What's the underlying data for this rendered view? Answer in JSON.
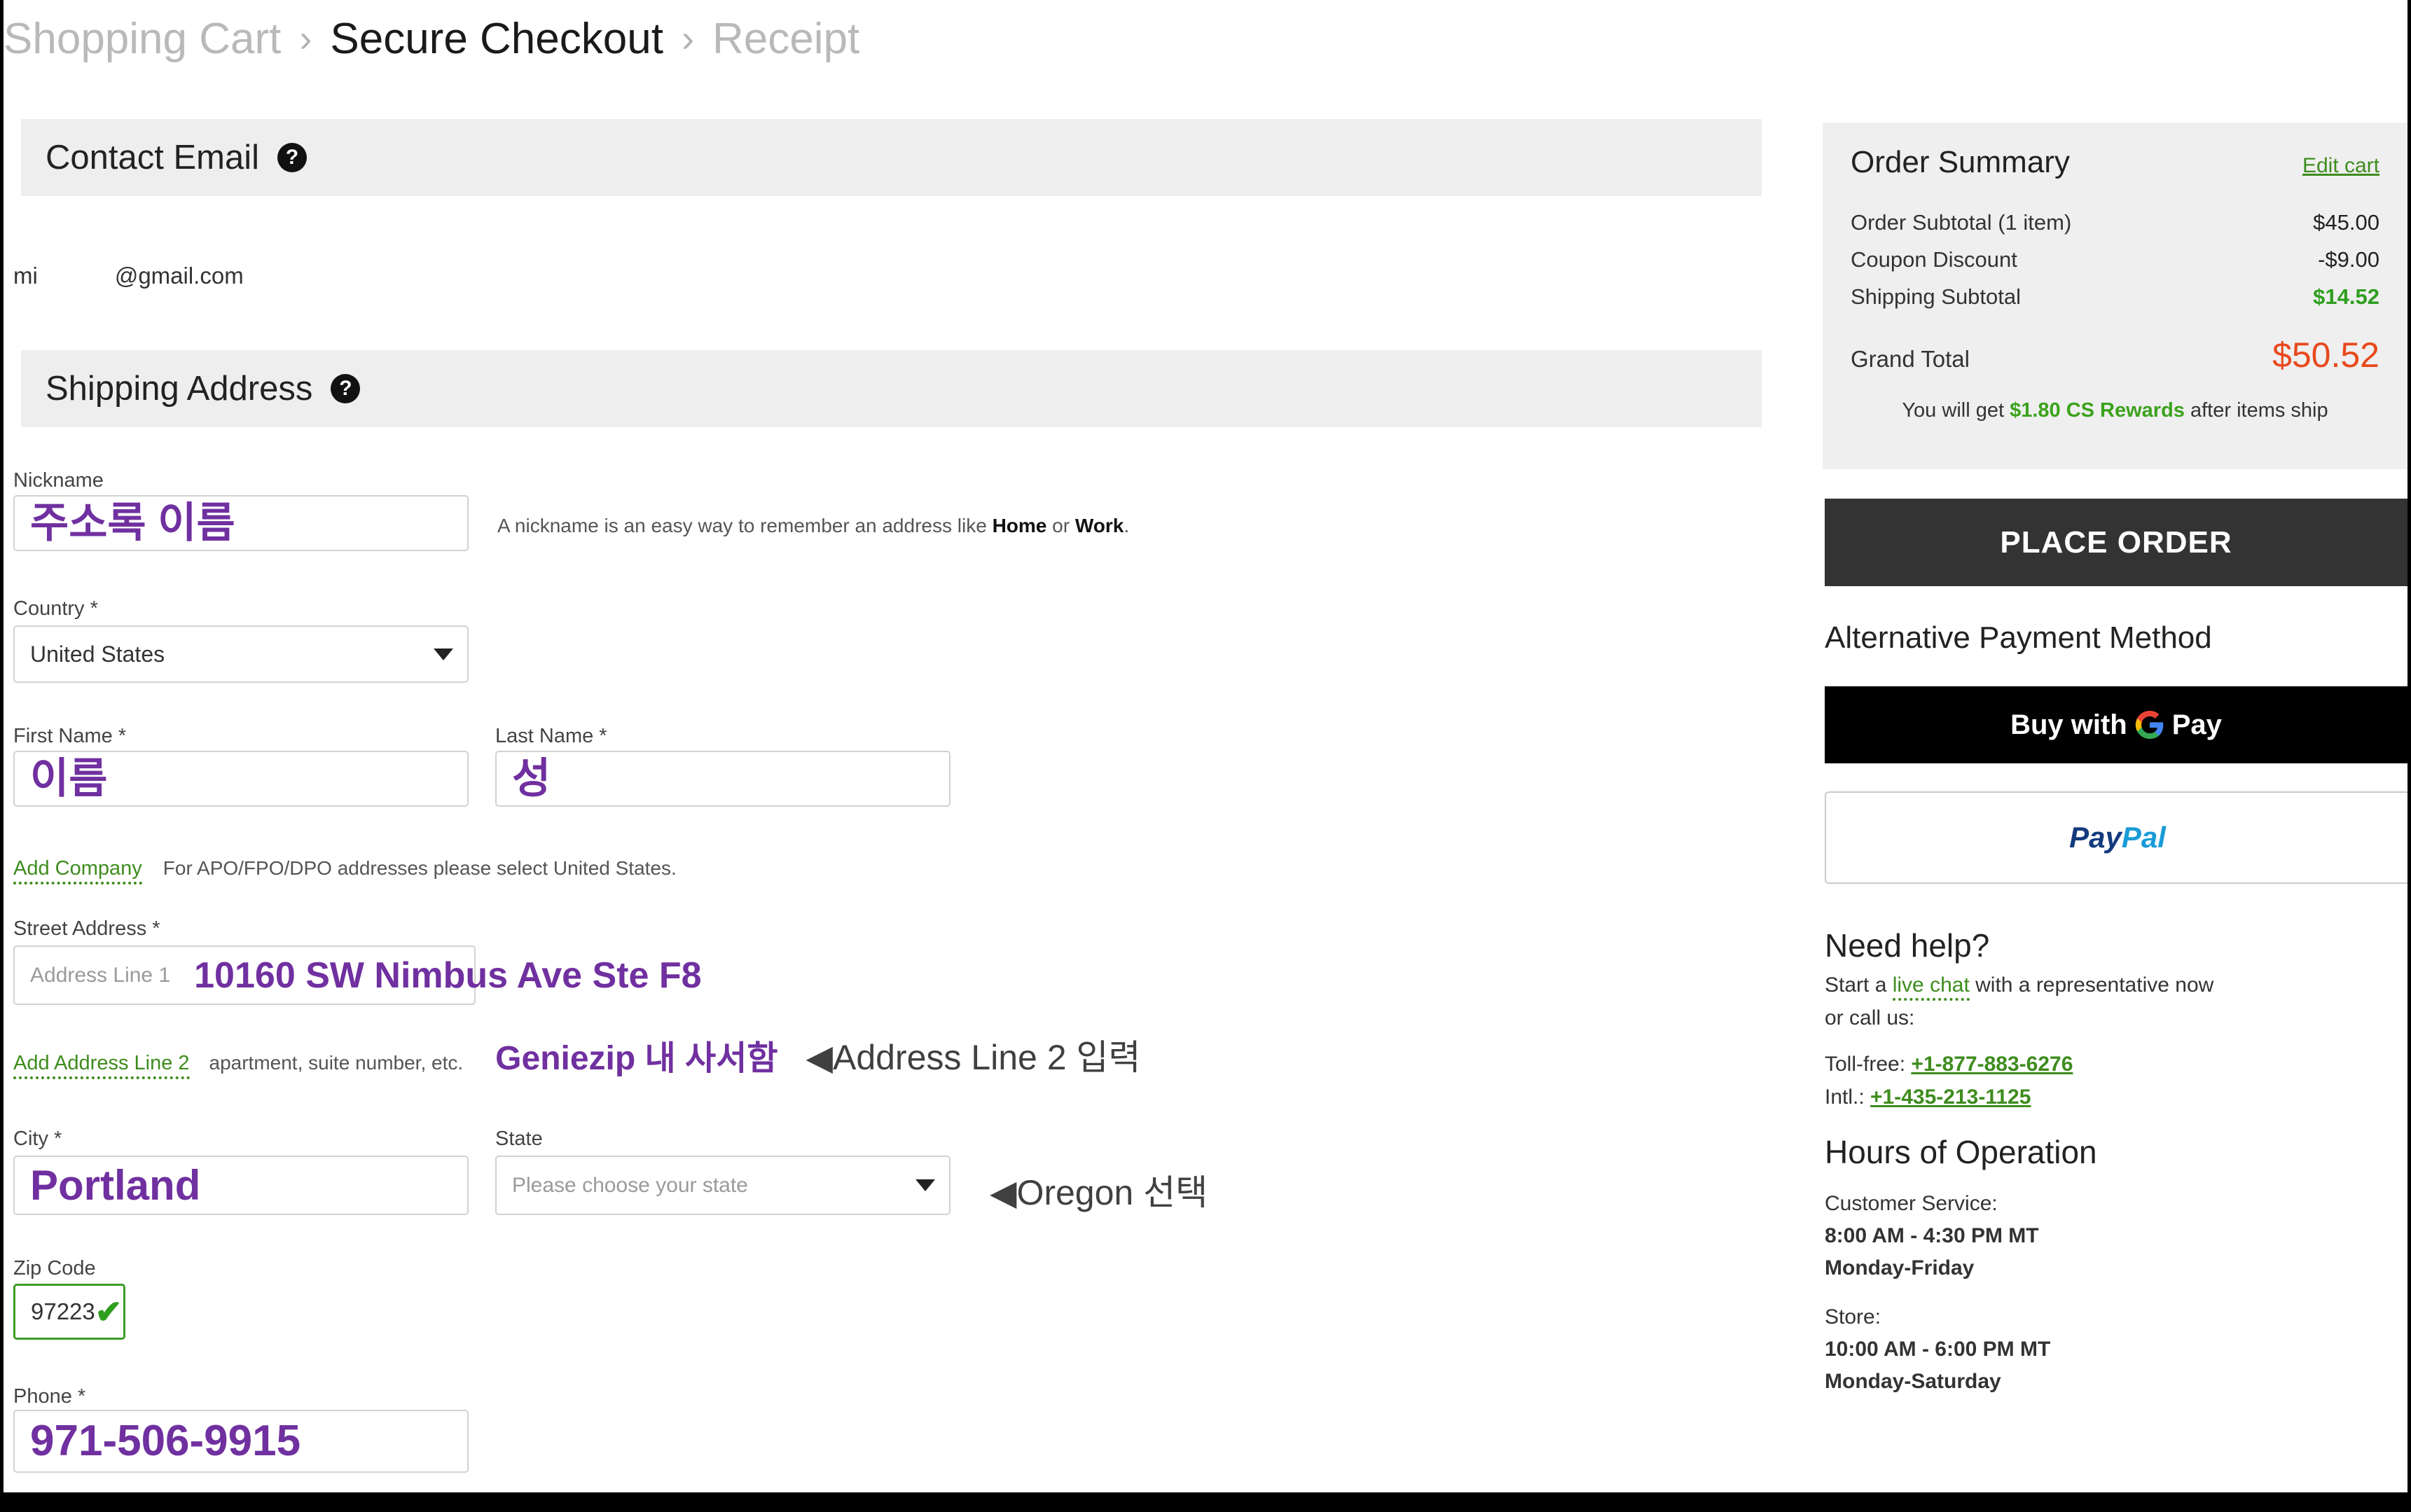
{
  "breadcrumb": {
    "items": [
      {
        "label": "Shopping Cart",
        "state": "inactive"
      },
      {
        "label": "Secure Checkout",
        "state": "active"
      },
      {
        "label": "Receipt",
        "state": "inactive"
      }
    ],
    "separator": "›"
  },
  "contact": {
    "section_title": "Contact Email",
    "help_icon": "question-mark-icon",
    "email_local": "mi",
    "email_domain": "@gmail.com"
  },
  "shipping": {
    "section_title": "Shipping Address",
    "help_icon": "question-mark-icon",
    "nickname": {
      "label": "Nickname",
      "value": "주소록 이름",
      "helper_prefix": "A nickname is an easy way to remember an address like ",
      "helper_home": "Home",
      "helper_or": " or ",
      "helper_work": "Work",
      "helper_suffix": "."
    },
    "country": {
      "label": "Country *",
      "value": "United States",
      "caret_icon": "chevron-down-icon"
    },
    "first_name": {
      "label": "First Name *",
      "value": "이름"
    },
    "last_name": {
      "label": "Last Name *",
      "value": "성"
    },
    "add_company_link": "Add Company",
    "apo_note": "For APO/FPO/DPO addresses please select United States.",
    "street": {
      "label": "Street Address *",
      "line1_placeholder": "Address Line 1",
      "line1_value": "10160 SW Nimbus Ave Ste F8"
    },
    "address_line2": {
      "link": "Add Address Line 2",
      "hint": "apartment, suite number, etc.",
      "value": "Geniezip 내 사서함",
      "annotation": "◀Address Line 2 입력"
    },
    "city": {
      "label": "City *",
      "value": "Portland"
    },
    "state": {
      "label": "State",
      "placeholder": "Please choose your state",
      "caret_icon": "chevron-down-icon",
      "annotation": "◀Oregon 선택"
    },
    "zip": {
      "label": "Zip Code",
      "value": "97223",
      "valid_icon": "✔"
    },
    "phone": {
      "label": "Phone *",
      "value": "971-506-9915"
    }
  },
  "order_summary": {
    "title": "Order Summary",
    "edit_cart": "Edit cart",
    "rows": [
      {
        "label": "Order Subtotal (1 item)",
        "value": "$45.00",
        "style": "normal"
      },
      {
        "label": "Coupon Discount",
        "value": "-$9.00",
        "style": "normal"
      },
      {
        "label": "Shipping Subtotal",
        "value": "$14.52",
        "style": "green"
      }
    ],
    "grand_total_label": "Grand Total",
    "grand_total_value": "$50.52",
    "rewards_prefix": "You will get ",
    "rewards_amount": "$1.80 CS Rewards",
    "rewards_suffix": " after items ship"
  },
  "actions": {
    "place_order": "PLACE ORDER",
    "alt_payment_title": "Alternative Payment Method",
    "gpay_before": "Buy with",
    "gpay_after": "Pay",
    "gpay_icon": "google-g-icon",
    "paypal_pay": "Pay",
    "paypal_pal": "Pal"
  },
  "help": {
    "title": "Need help?",
    "chat_prefix": "Start a ",
    "chat_link": "live chat",
    "chat_suffix": " with a representative now",
    "call_us": "or call us:",
    "tollfree_label": "Toll-free: ",
    "tollfree_number": "+1-877-883-6276",
    "intl_label": "Intl.: ",
    "intl_number": "+1-435-213-1125"
  },
  "hours": {
    "title": "Hours of Operation",
    "cs_label": "Customer Service:",
    "cs_time": "8:00 AM - 4:30 PM MT",
    "cs_days": "Monday-Friday",
    "store_label": "Store:",
    "store_time": "10:00 AM - 6:00 PM MT",
    "store_days": "Monday-Saturday"
  },
  "colors": {
    "handwriting_purple": "#7030a0",
    "link_green": "#3e8c1e",
    "total_orange": "#e8491d",
    "valid_green": "#3c9c28"
  }
}
